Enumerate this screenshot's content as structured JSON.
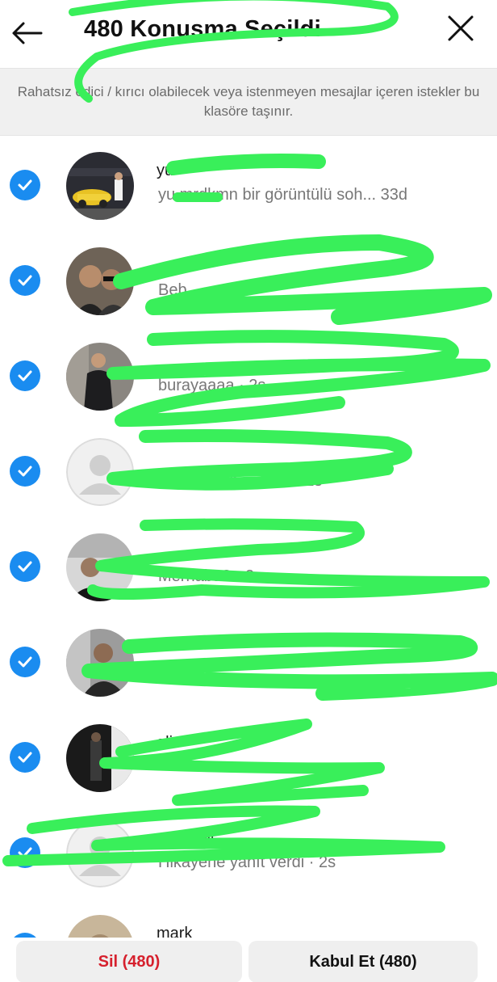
{
  "header": {
    "title": "480 Konuşma Seçildi",
    "back_icon": "arrow-left-icon",
    "close_icon": "close-icon"
  },
  "banner": {
    "text": "Rahatsız edici / kırıcı olabilecek veya istenmeyen mesajlar içeren istekler bu klasöre taşınır."
  },
  "rows": [
    {
      "name": "yu",
      "preview": "yu   mrdkmn bir görüntülü soh... 33d"
    },
    {
      "name": "",
      "preview": "Beb"
    },
    {
      "name": "",
      "preview": "burayaaaa · 2s"
    },
    {
      "name": "",
      "preview": "Hadi cevap ver aw · 2s"
    },
    {
      "name": "",
      "preview": "Merhaba? · 2s"
    },
    {
      "name": "",
      "preview": ""
    },
    {
      "name": "ali",
      "preview": ""
    },
    {
      "name": "mehmet",
      "preview": "Hikayene yanıt verdi · 2s"
    },
    {
      "name": "mark",
      "preview": ""
    }
  ],
  "actions": {
    "delete_label": "Sil (480)",
    "accept_label": "Kabul Et (480)"
  },
  "colors": {
    "check_blue": "#1a8cf0",
    "delete_red": "#d6202d",
    "scribble_green": "#39ef5a"
  }
}
